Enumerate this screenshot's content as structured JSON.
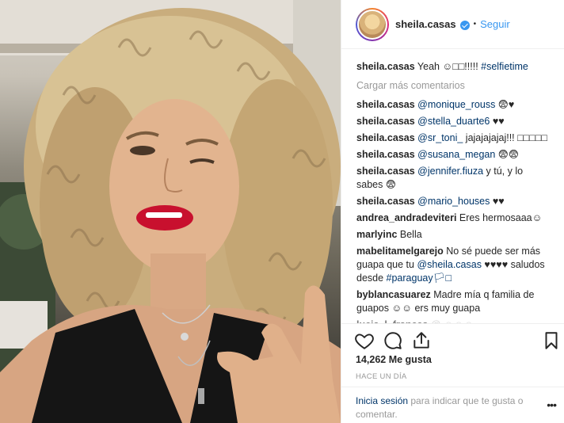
{
  "header": {
    "username": "sheila.casas",
    "dot": "•",
    "follow_label": "Seguir"
  },
  "caption": {
    "user": "sheila.casas",
    "text": "Yeah ☺□□!!!!! ",
    "hashtag": "#selfietime"
  },
  "load_more": "Cargar más comentarios",
  "comments": [
    {
      "user": "sheila.casas",
      "mention": "@monique_rouss",
      "text": " 😨♥"
    },
    {
      "user": "sheila.casas",
      "mention": "@stella_duarte6",
      "text": " ♥♥"
    },
    {
      "user": "sheila.casas",
      "mention": "@sr_toni_",
      "text": " jajajajajaj!!! □□□□□"
    },
    {
      "user": "sheila.casas",
      "mention": "@susana_megan",
      "text": " 😨😨"
    },
    {
      "user": "sheila.casas",
      "mention": "@jennifer.fiuza",
      "text": " y tú, y lo sabes 😨"
    },
    {
      "user": "sheila.casas",
      "mention": "@mario_houses",
      "text": " ♥♥"
    }
  ],
  "others": [
    {
      "user": "andrea_andradeviteri",
      "text": " Eres hermosaaa☺"
    },
    {
      "user": "marlyinc",
      "text": " Bella"
    },
    {
      "user": "mabelitamelgarejo",
      "text": " No sé puede ser más guapa que tu ",
      "mention": "@sheila.casas",
      "text2": " ♥♥♥♥ saludos desde ",
      "mention2": "#paraguay🏳□"
    },
    {
      "user": "byblancasuarez",
      "text": " Madre mía q familia de guapos ☺☺ ers muy guapa"
    },
    {
      "user": "lucia_l_frances",
      "text": " @ ☺☺☺"
    }
  ],
  "likes": "14,262 Me gusta",
  "time": "HACE UN DÍA",
  "footer": {
    "login": "Inicia sesión",
    "rest": " para indicar que te gusta o comentar."
  },
  "more_label": "•••",
  "icons": {
    "like": "heart-icon",
    "comment": "comment-bubble-icon",
    "share": "share-icon",
    "save": "bookmark-icon"
  },
  "colors": {
    "link": "#3897f0",
    "mention": "#003569",
    "muted": "#999999",
    "text": "#262626",
    "border": "#efefef"
  }
}
